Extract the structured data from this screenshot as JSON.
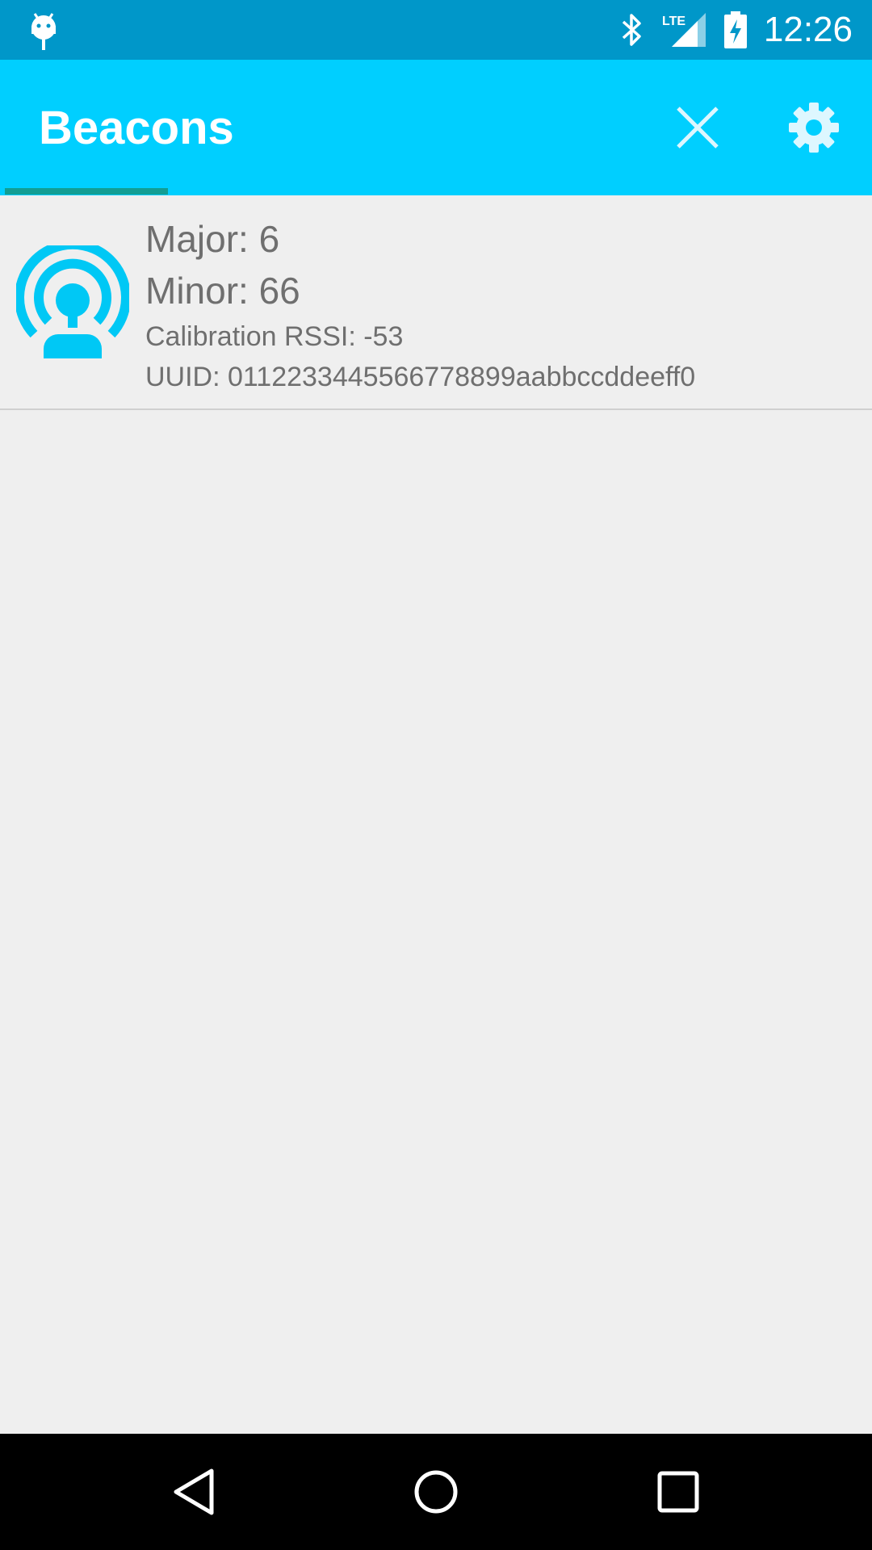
{
  "status_bar": {
    "network": "LTE",
    "time": "12:26",
    "icons": [
      "android-debug-icon",
      "bluetooth-icon",
      "lte-signal-icon",
      "battery-charging-icon"
    ]
  },
  "app_bar": {
    "title": "Beacons",
    "actions": [
      "close-icon",
      "settings-gear-icon"
    ],
    "accent_color": "#00CFFF",
    "status_color": "#0097C9",
    "indicator_color": "#129E94"
  },
  "beacons": [
    {
      "major": "Major: 6",
      "minor": "Minor: 66",
      "calibration": "Calibration RSSI: -53",
      "uuid": "UUID: 0112233445566778899aabbccddeeff0",
      "icon": "beacon-icon"
    }
  ],
  "nav_bar": {
    "buttons": [
      "back-icon",
      "home-icon",
      "recents-icon"
    ]
  }
}
